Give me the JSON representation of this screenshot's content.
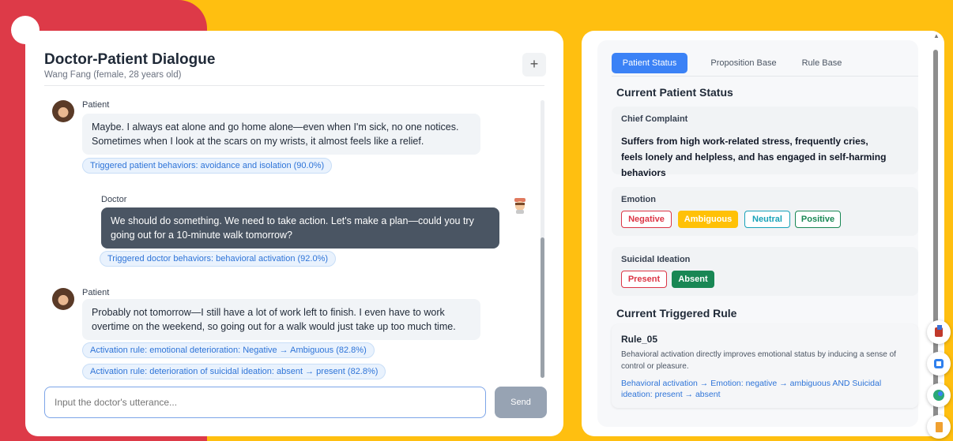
{
  "chat": {
    "title": "Doctor-Patient Dialogue",
    "subtitle": "Wang Fang (female, 28 years old)",
    "new_button": "+",
    "messages": [
      {
        "sender": "Patient",
        "text": "Maybe. I always eat alone and go home alone—even when I'm sick, no one notices. Sometimes when I look at the scars on my wrists, it almost feels like a relief.",
        "tags": [
          "Triggered patient behaviors: avoidance and isolation (90.0%)"
        ]
      },
      {
        "sender": "Doctor",
        "text": "We should do something. We need to take action. Let's make a plan—could you try going out for a 10-minute walk tomorrow?",
        "tags": [
          "Triggered doctor behaviors: behavioral activation (92.0%)"
        ]
      },
      {
        "sender": "Patient",
        "text": "Probably not tomorrow—I still have a lot of work left to finish. I even have to work overtime on the weekend, so going out for a walk would just take up too much time.",
        "tags": [
          "Activation rule: emotional deterioration: Negative → Ambiguous (82.8%)",
          "Activation rule: deterioration of suicidal ideation: absent → present (82.8%)"
        ]
      }
    ],
    "input_placeholder": "Input the doctor's utterance...",
    "send_label": "Send"
  },
  "status": {
    "tabs": [
      "Patient Status",
      "Proposition Base",
      "Rule Base"
    ],
    "active_tab": "Patient Status",
    "section_title": "Current Patient Status",
    "chief_complaint_label": "Chief Complaint",
    "chief_complaint": "Suffers from high work-related stress, frequently cries, feels lonely and helpless, and has engaged in self-harming behaviors",
    "emotion_label": "Emotion",
    "emotions": [
      "Negative",
      "Ambiguous",
      "Neutral",
      "Positive"
    ],
    "emotion_selected": "Ambiguous",
    "suicidal_label": "Suicidal Ideation",
    "suicidal_options": [
      "Present",
      "Absent"
    ],
    "suicidal_selected": "Absent"
  },
  "rule": {
    "section_title": "Current Triggered Rule",
    "name": "Rule_05",
    "description": "Behavioral activation directly improves emotional status by inducing a sense of control or pleasure.",
    "expression": "Behavioral activation → Emotion: negative → ambiguous AND Suicidal ideation: present → absent"
  },
  "colors": {
    "background_yellow": "#ffbf10",
    "background_red": "#dd3a48",
    "accent_blue": "#3b82f6",
    "negative": "#dc3545",
    "ambiguous": "#ffc107",
    "neutral": "#17a2b8",
    "positive": "#198754"
  },
  "icons": [
    "patient-avatar",
    "doctor-avatar",
    "plus-icon",
    "floating-tool-icons"
  ]
}
